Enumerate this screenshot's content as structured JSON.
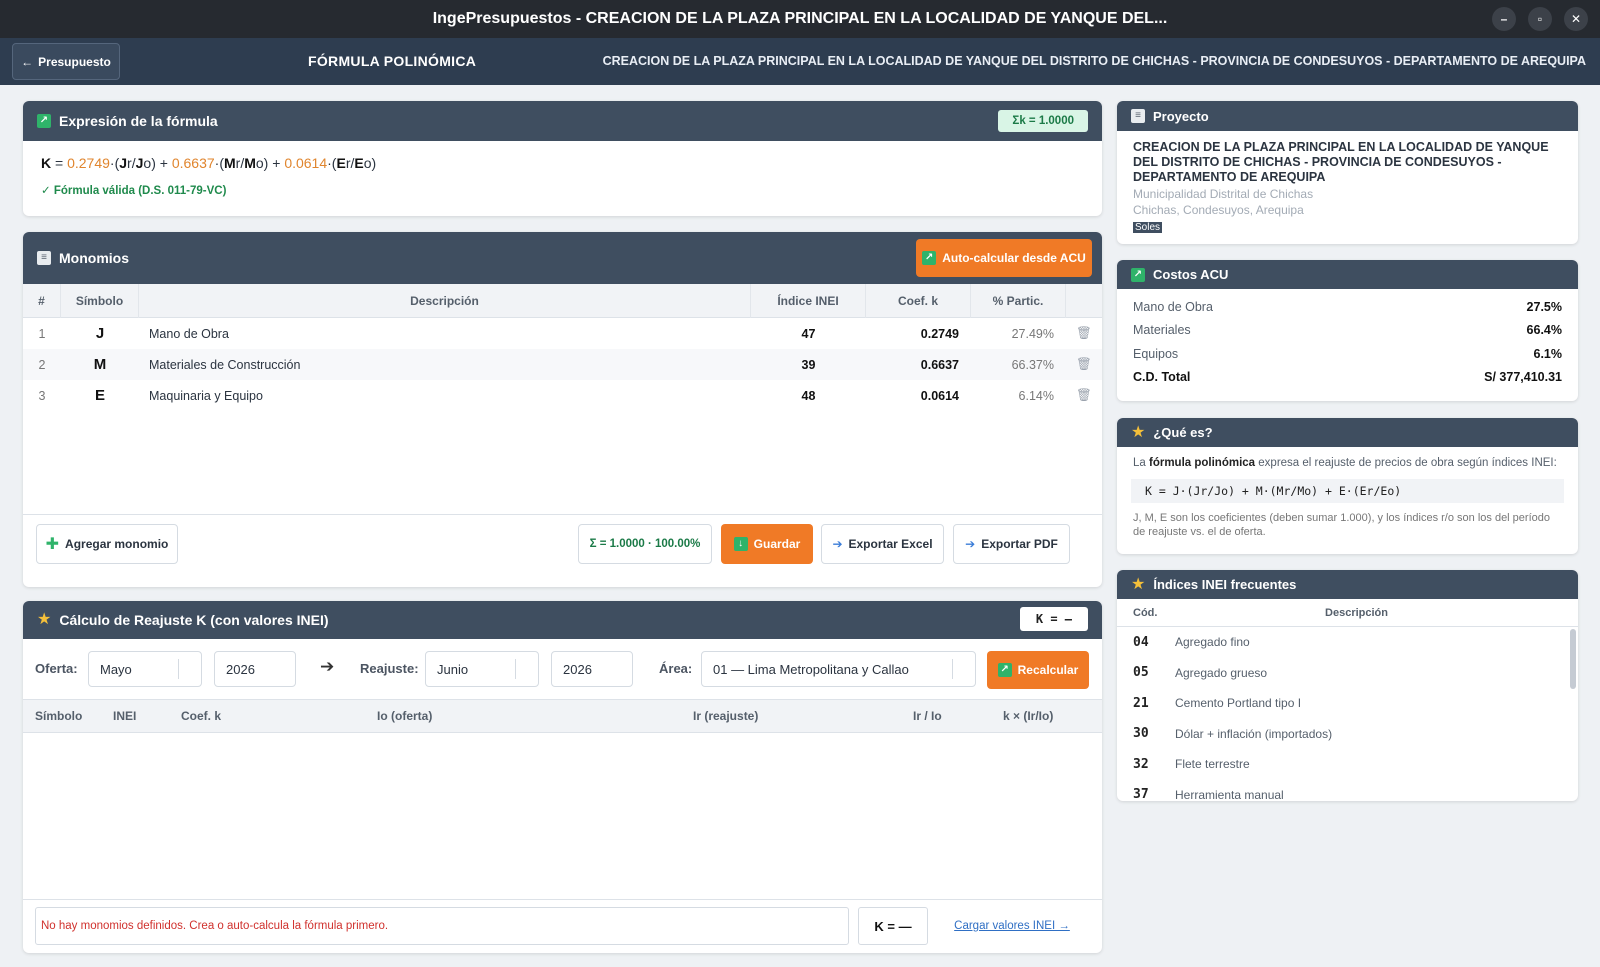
{
  "window": {
    "title": "IngePresupuestos  -  CREACION DE LA PLAZA PRINCIPAL EN LA LOCALIDAD DE YANQUE DEL..."
  },
  "header": {
    "back_label": "Presupuesto",
    "title": "FÓRMULA POLINÓMICA",
    "project": "CREACION DE LA PLAZA PRINCIPAL EN LA LOCALIDAD DE YANQUE DEL DISTRITO DE CHICHAS - PROVINCIA DE CONDESUYOS - DEPARTAMENTO DE AREQUIPA"
  },
  "formula": {
    "title": "Expresión de la fórmula",
    "sum_badge": "Σk = 1.0000",
    "k": "K",
    "eq": " = ",
    "terms": [
      {
        "coef": "0.2749",
        "sym": "J",
        "expr_pre": "·(",
        "r": "r/",
        "o": "o)"
      },
      {
        "coef": "0.6637",
        "sym": "M",
        "expr_pre": "·(",
        "r": "r/",
        "o": "o)"
      },
      {
        "coef": "0.0614",
        "sym": "E",
        "expr_pre": "·(",
        "r": "r/",
        "o": "o)"
      }
    ],
    "plus": " + ",
    "valid_text": "Fórmula válida (D.S. 011-79-VC)"
  },
  "monomios": {
    "title": "Monomios",
    "auto_button": "Auto-calcular desde ACU",
    "columns": [
      "#",
      "Símbolo",
      "Descripción",
      "Índice INEI",
      "Coef. k",
      "% Partic."
    ],
    "rows": [
      {
        "n": "1",
        "sym": "J",
        "desc": "Mano de Obra",
        "inei": "47",
        "coef": "0.2749",
        "pct": "27.49%"
      },
      {
        "n": "2",
        "sym": "M",
        "desc": "Materiales de Construcción",
        "inei": "39",
        "coef": "0.6637",
        "pct": "66.37%"
      },
      {
        "n": "3",
        "sym": "E",
        "desc": "Maquinaria y Equipo",
        "inei": "48",
        "coef": "0.0614",
        "pct": "6.14%"
      }
    ],
    "add_button": "Agregar monomio",
    "sum_text": "Σ = 1.0000  ·  100.00%",
    "save_button": "Guardar",
    "excel_button": "Exportar Excel",
    "pdf_button": "Exportar PDF"
  },
  "reajuste": {
    "title": "Cálculo de Reajuste K (con valores INEI)",
    "k_badge": "K = –",
    "oferta_label": "Oferta:",
    "oferta_month": "Mayo",
    "oferta_year": "2026",
    "reajuste_label": "Reajuste:",
    "reajuste_month": "Junio",
    "reajuste_year": "2026",
    "area_label": "Área:",
    "area_value": "01 — Lima Metropolitana y Callao",
    "recalc_button": "Recalcular",
    "columns": [
      "Símbolo",
      "INEI",
      "Coef. k",
      "Io (oferta)",
      "Ir (reajuste)",
      "Ir / Io",
      "k × (Ir/Io)"
    ],
    "message": "No hay monomios definidos. Crea o auto-calcula la fórmula primero.",
    "k_result": "K = —",
    "load_link": "Cargar valores INEI →"
  },
  "proyecto": {
    "title": "Proyecto",
    "name": "CREACION DE LA PLAZA PRINCIPAL EN LA LOCALIDAD DE YANQUE DEL DISTRITO DE CHICHAS - PROVINCIA DE CONDESUYOS - DEPARTAMENTO DE AREQUIPA",
    "entity": "Municipalidad Distrital de Chichas",
    "location": "Chichas, Condesuyos, Arequipa",
    "currency": "Soles"
  },
  "costos": {
    "title": "Costos ACU",
    "rows": [
      {
        "label": "Mano de Obra",
        "value": "27.5%"
      },
      {
        "label": "Materiales",
        "value": "66.4%"
      },
      {
        "label": "Equipos",
        "value": "6.1%"
      }
    ],
    "total_label": "C.D. Total",
    "total_value": "S/ 377,410.31"
  },
  "que_es": {
    "title": "¿Qué es?",
    "p1_pre": "La ",
    "p1_bold": "fórmula polinómica",
    "p1_post": " expresa el reajuste de precios de obra según índices INEI:",
    "code": "K = J·(Jr/Jo) + M·(Mr/Mo) + E·(Er/Eo)",
    "p2": "J, M, E son los coeficientes (deben sumar 1.000), y los índices r/o son los del período de reajuste vs. el de oferta."
  },
  "indices": {
    "title": "Índices INEI frecuentes",
    "col_code": "Cód.",
    "col_desc": "Descripción",
    "rows": [
      {
        "code": "04",
        "desc": "Agregado fino"
      },
      {
        "code": "05",
        "desc": "Agregado grueso"
      },
      {
        "code": "21",
        "desc": "Cemento Portland tipo I"
      },
      {
        "code": "30",
        "desc": "Dólar + inflación (importados)"
      },
      {
        "code": "32",
        "desc": "Flete terrestre"
      },
      {
        "code": "37",
        "desc": "Herramienta manual"
      }
    ]
  },
  "colors": {
    "accent": "#f07a26",
    "header": "#2e3d50",
    "card_head": "#3f4e60",
    "success": "#1f8a4c",
    "error": "#d0312d"
  }
}
